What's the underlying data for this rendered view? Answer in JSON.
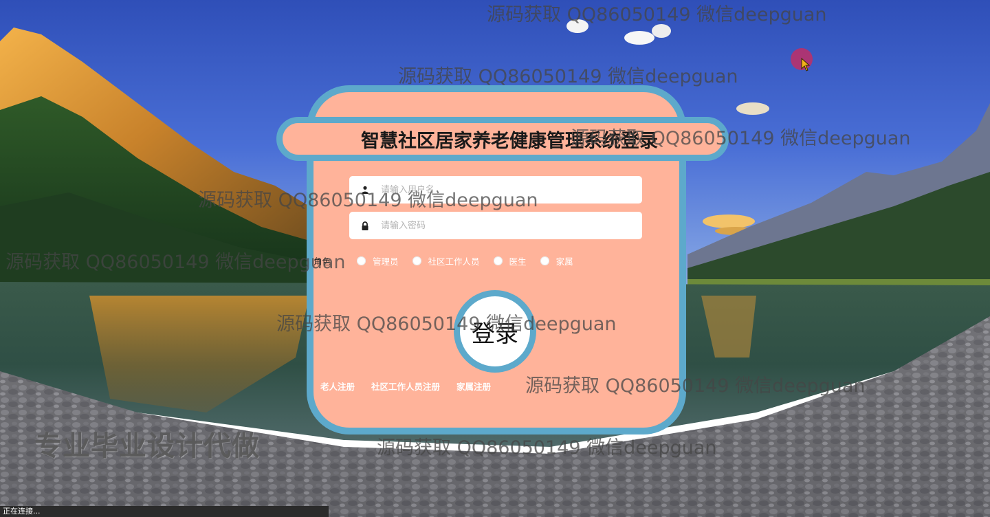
{
  "login": {
    "title": "智慧社区居家养老健康管理系统登录",
    "username_placeholder": "请输入用户名",
    "password_placeholder": "请输入密码",
    "role_label": "角色",
    "roles": [
      "管理员",
      "社区工作人员",
      "医生",
      "家属"
    ],
    "login_button": "登录",
    "register_links": [
      "老人注册",
      "社区工作人员注册",
      "家属注册"
    ],
    "icons": {
      "username": "user-icon",
      "password": "lock-icon"
    }
  },
  "promo_text": "专业毕业设计代做",
  "watermark_text": "源码获取 QQ86050149 微信deepguan",
  "status_bar": "正在连接...",
  "colors": {
    "card": "#ffb39a",
    "border": "#5da9cb"
  }
}
